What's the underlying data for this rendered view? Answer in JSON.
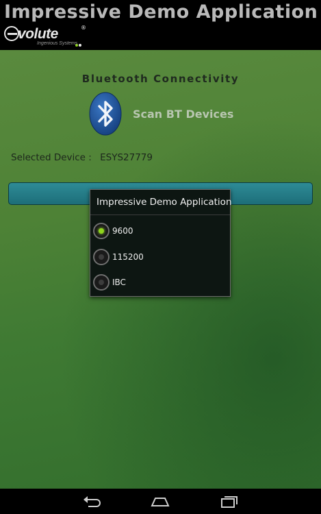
{
  "app": {
    "title": "Impressive Demo Application"
  },
  "logo": {
    "word": "volute",
    "tagline": "Ingenious Systems",
    "registered": "®"
  },
  "main": {
    "section_title": "Bluetooth Connectivity",
    "scan_label": "Scan BT Devices",
    "selected_device_label": "Selected Device :",
    "selected_device_value": "ESYS27779"
  },
  "dialog": {
    "title": "Impressive Demo Application",
    "options": [
      {
        "label": "9600",
        "checked": true
      },
      {
        "label": "115200",
        "checked": false
      },
      {
        "label": "IBC",
        "checked": false
      }
    ]
  },
  "navbar": {
    "buttons": [
      "back-icon",
      "home-icon",
      "recent-apps-icon"
    ]
  },
  "colors": {
    "accent_green": "#8fd61d",
    "bluetooth_blue": "#1d4f96",
    "connect_bar": "#2a8390"
  }
}
